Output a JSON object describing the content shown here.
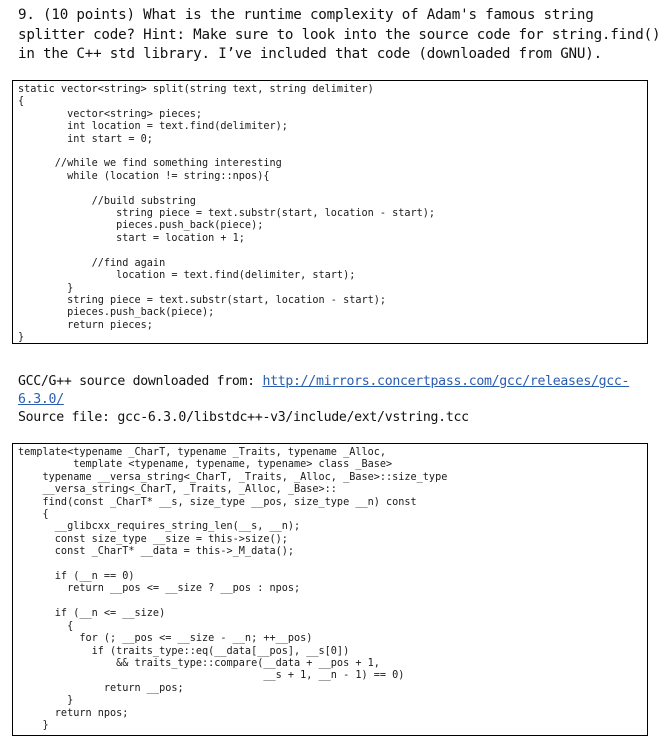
{
  "question": {
    "lines": [
      "9. (10 points) What is the runtime complexity of Adam's famous string",
      "splitter code? Hint: Make sure to look into the source code for string.find()",
      "in the C++ std library. I’ve included that code (downloaded from GNU)."
    ]
  },
  "split_code": {
    "lines": [
      "static vector<string> split(string text, string delimiter)",
      "{",
      "        vector<string> pieces;",
      "        int location = text.find(delimiter);",
      "        int start = 0;",
      "",
      "      //while we find something interesting",
      "        while (location != string::npos){",
      "",
      "            //build substring",
      "                string piece = text.substr(start, location - start);",
      "                pieces.push_back(piece);",
      "                start = location + 1;",
      "",
      "            //find again",
      "                location = text.find(delimiter, start);",
      "        }",
      "        string piece = text.substr(start, location - start);",
      "        pieces.push_back(piece);",
      "        return pieces;",
      "}"
    ]
  },
  "source_info": {
    "downloaded_label": "GCC/G++ source downloaded from: ",
    "link_part1": "http://mirrors.concertpass.com/gcc/releases/gcc-",
    "link_part2": "6.3.0/",
    "source_file_line": "Source file: gcc-6.3.0/libstdc++-v3/include/ext/vstring.tcc"
  },
  "find_code": {
    "lines": [
      "template<typename _CharT, typename _Traits, typename _Alloc,",
      "         template <typename, typename, typename> class _Base>",
      "    typename __versa_string<_CharT, _Traits, _Alloc, _Base>::size_type",
      "    __versa_string<_CharT, _Traits, _Alloc, _Base>::",
      "    find(const _CharT* __s, size_type __pos, size_type __n) const",
      "    {",
      "      __glibcxx_requires_string_len(__s, __n);",
      "      const size_type __size = this->size();",
      "      const _CharT* __data = this->_M_data();",
      "",
      "      if (__n == 0)",
      "        return __pos <= __size ? __pos : npos;",
      "",
      "      if (__n <= __size)",
      "        {",
      "          for (; __pos <= __size - __n; ++__pos)",
      "            if (traits_type::eq(__data[__pos], __s[0])",
      "                && traits_type::compare(__data + __pos + 1,",
      "                                        __s + 1, __n - 1) == 0)",
      "              return __pos;",
      "        }",
      "      return npos;",
      "    }"
    ]
  }
}
